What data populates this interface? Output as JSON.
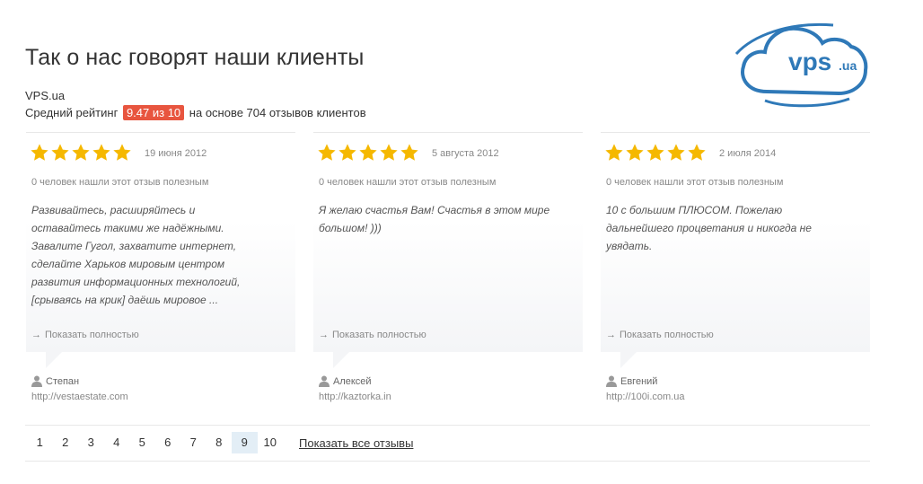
{
  "header": {
    "title": "Так о нас говорят наши клиенты",
    "company": "VPS.ua",
    "rating_prefix": "Средний рейтинг",
    "rating_value": "9.47 из 10",
    "rating_suffix": "на основе 704 отзывов клиентов"
  },
  "logo": {
    "text": "vps",
    "suffix": ".ua"
  },
  "colors": {
    "badge": "#e8553f",
    "star": "#f5b800",
    "logo_blue": "#2f79b8",
    "active_page": "#e3eef6"
  },
  "reviews": [
    {
      "stars": 5,
      "date": "19 июня 2012",
      "helpful": "0 человек нашли этот отзыв полезным",
      "text": "Развивайтесь, расширяйтесь и оставайтесь такими же надёжными. Завалите Гугол, захватите интернет, сделайте Харьков мировым центром развития информационных технологий, [срываясь на крик] даёшь мировое ...",
      "show_full": "Показать полностью",
      "author": "Степан",
      "url": "http://vestaestate.com"
    },
    {
      "stars": 5,
      "date": "5 августа 2012",
      "helpful": "0 человек нашли этот отзыв полезным",
      "text": "Я желаю счастья Вам! Счастья в этом мире большом! )))",
      "show_full": "Показать полностью",
      "author": "Алексей",
      "url": "http://kaztorka.in"
    },
    {
      "stars": 5,
      "date": "2 июля 2014",
      "helpful": "0 человек нашли этот отзыв полезным",
      "text": "10 с большим ПЛЮСОМ. Пожелаю дальнейшего процветания и никогда не увядать.",
      "show_full": "Показать полностью",
      "author": "Евгений",
      "url": "http://100i.com.ua"
    }
  ],
  "pagination": {
    "pages": [
      "1",
      "2",
      "3",
      "4",
      "5",
      "6",
      "7",
      "8",
      "9",
      "10"
    ],
    "active": "9",
    "show_all": "Показать все отзывы"
  }
}
